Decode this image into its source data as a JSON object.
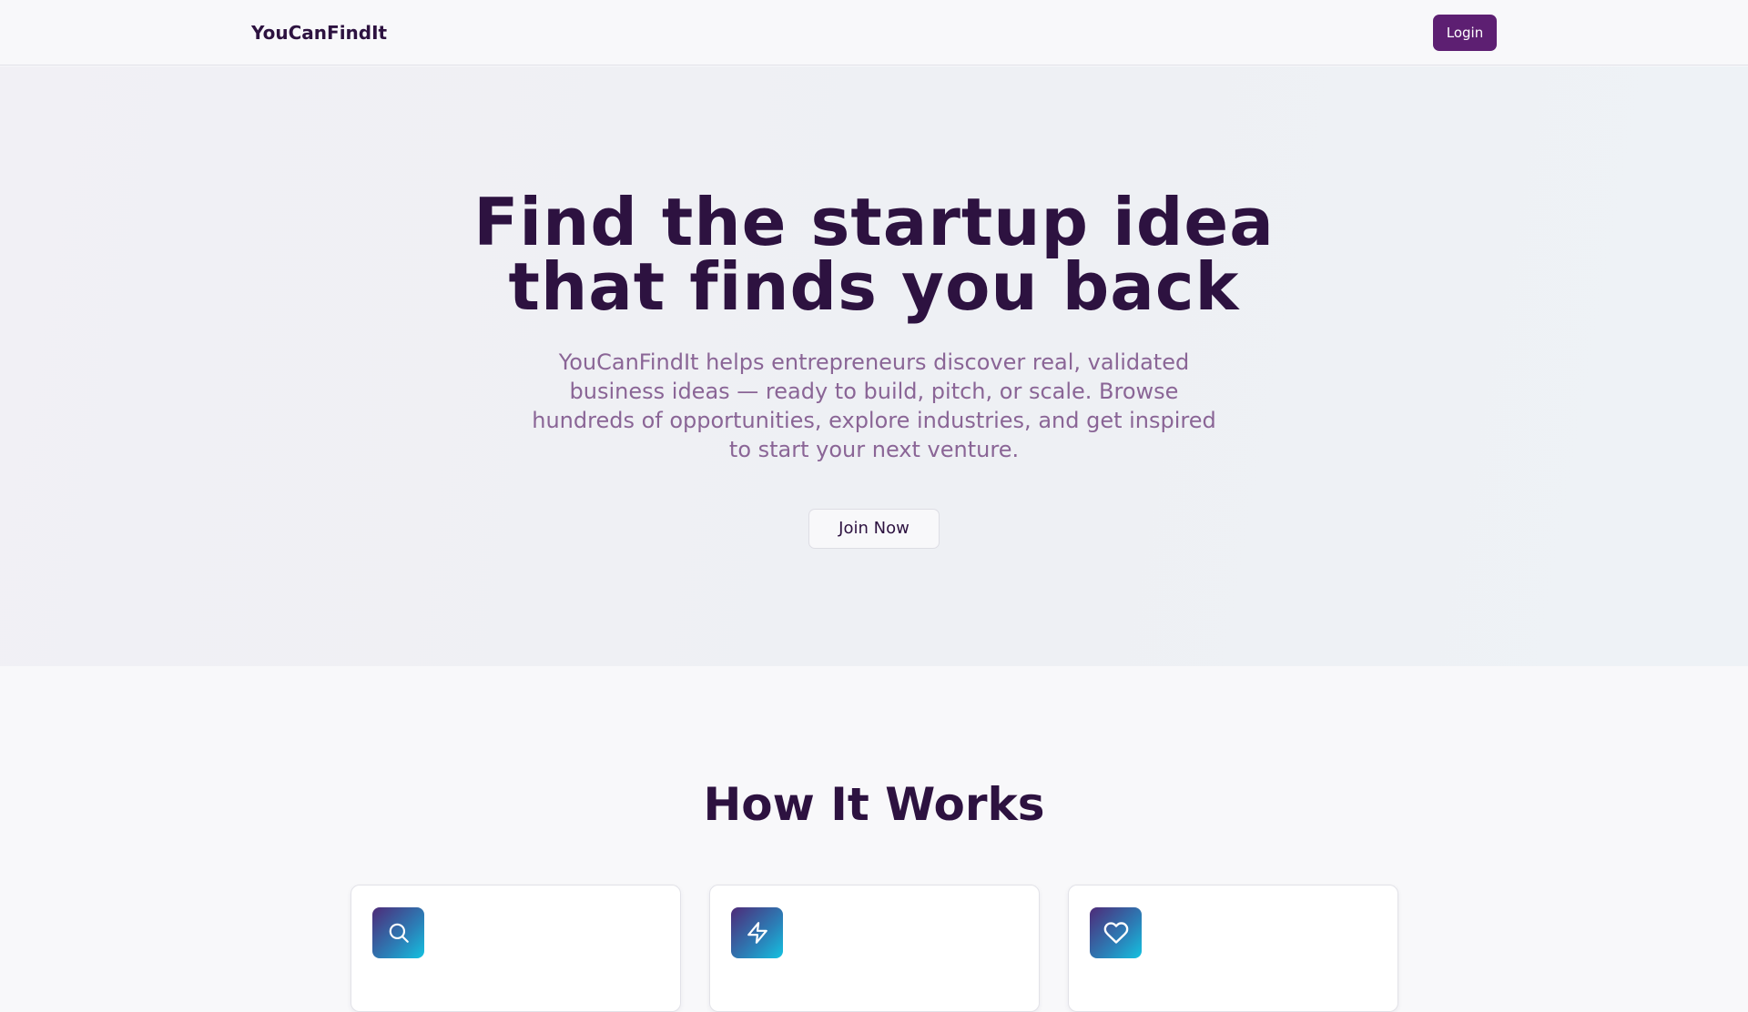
{
  "header": {
    "brand": "YouCanFindIt",
    "login_label": "Login"
  },
  "hero": {
    "title_line1": "Find the startup idea",
    "title_line2": "that finds you back",
    "subtitle": "YouCanFindIt helps entrepreneurs discover real, validated business ideas — ready to build, pitch, or scale. Browse hundreds of opportunities, explore industries, and get inspired to start your next venture.",
    "join_label": "Join Now"
  },
  "how_it_works": {
    "title": "How It Works",
    "cards": [
      {
        "icon": "search-icon"
      },
      {
        "icon": "lightning-icon"
      },
      {
        "icon": "heart-icon"
      }
    ]
  },
  "colors": {
    "brand_text": "#2d1240",
    "accent": "#5d1f72",
    "subtitle": "#8a6596",
    "icon_gradient_start": "#4e2a78",
    "icon_gradient_end": "#14c2e0"
  }
}
